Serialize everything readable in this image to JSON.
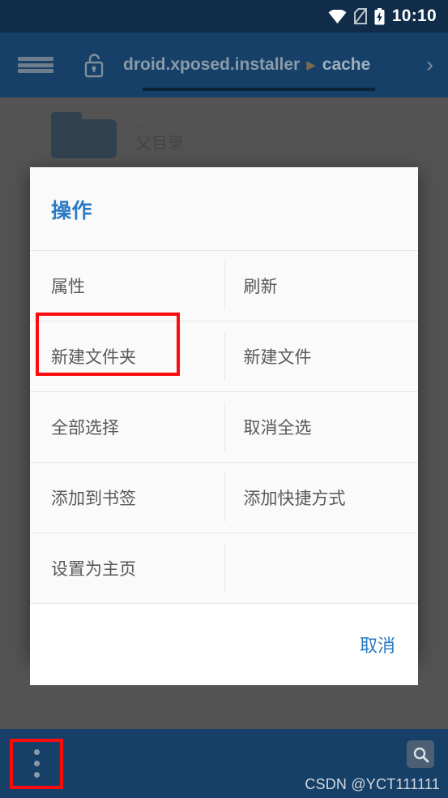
{
  "status_bar": {
    "time": "10:10",
    "icons": [
      "wifi-icon",
      "no-sim-icon",
      "battery-charging-icon"
    ]
  },
  "toolbar": {
    "menu_icon": "hamburger-menu-icon",
    "lock_icon": "unlocked-padlock-icon",
    "breadcrumbs": [
      {
        "label": "droid.xposed.installer"
      },
      {
        "label": "cache"
      }
    ],
    "separator": "▶",
    "overflow_chevron": "›"
  },
  "file_list": {
    "items": [
      {
        "sub": "..",
        "name": "父目录",
        "icon": "folder-icon"
      }
    ]
  },
  "dialog": {
    "title": "操作",
    "title_color": "#2a7ac4",
    "rows": [
      {
        "left": "属性",
        "right": "刷新"
      },
      {
        "left": "新建文件夹",
        "right": "新建文件",
        "left_highlighted": true
      },
      {
        "left": "全部选择",
        "right": "取消全选"
      },
      {
        "left": "添加到书签",
        "right": "添加快捷方式"
      },
      {
        "left": "设置为主页",
        "right": ""
      }
    ],
    "cancel_label": "取消"
  },
  "bottom_bar": {
    "overflow_icon": "overflow-vertical-dots-icon",
    "overflow_highlighted": true,
    "search_icon": "search-icon"
  },
  "watermark": {
    "text": "CSDN @YCT111111"
  },
  "highlight_color": "#fb0b0b"
}
